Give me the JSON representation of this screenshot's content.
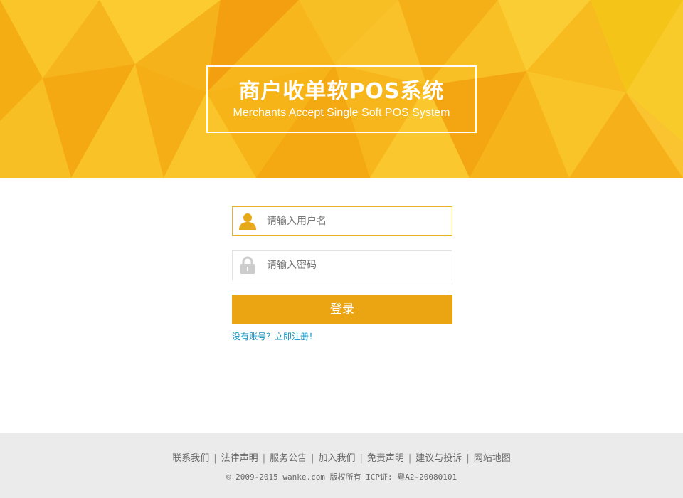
{
  "banner": {
    "title_cn": "商户收单软POS系统",
    "title_en": "Merchants Accept Single Soft POS System"
  },
  "login_form": {
    "username_placeholder": "请输入用户名",
    "password_placeholder": "请输入密码",
    "login_label": "登录",
    "register_link": "没有账号？立即注册！"
  },
  "footer": {
    "links": [
      "联系我们",
      "法律声明",
      "服务公告",
      "加入我们",
      "免责声明",
      "建议与投诉",
      "网站地图"
    ],
    "separator": "|",
    "copyright": "© 2009-2015 wanke.com 版权所有 ICP证: 粤A2-20080101"
  },
  "colors": {
    "banner_yellow": "#f7b81a",
    "button_orange": "#eba412",
    "focused_border": "#e9b229",
    "icon_active": "#e7a91c",
    "icon_inactive": "#cccccc",
    "link_blue": "#0e8fbe",
    "footer_bg": "#ebebeb"
  },
  "icons": {
    "username": "user-icon",
    "password": "lock-icon"
  }
}
